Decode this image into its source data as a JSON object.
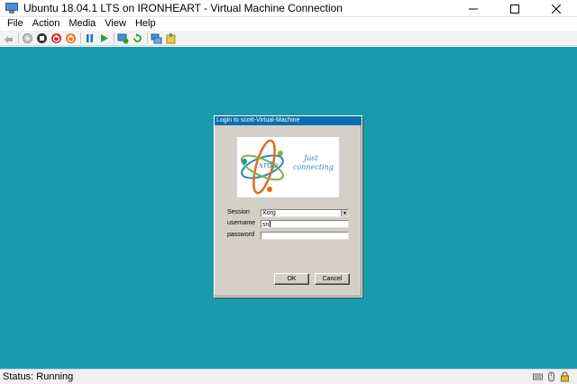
{
  "window": {
    "title": "Ubuntu 18.04.1 LTS on IRONHEART - Virtual Machine Connection",
    "controls": {
      "minimize": "—",
      "maximize": "☐",
      "close": "✕"
    }
  },
  "menubar": {
    "items": [
      {
        "label": "File"
      },
      {
        "label": "Action"
      },
      {
        "label": "Media"
      },
      {
        "label": "View"
      },
      {
        "label": "Help"
      }
    ]
  },
  "toolbar": {
    "buttons": [
      {
        "icon": "ctrl-alt-del-icon"
      },
      {
        "icon": "start-icon"
      },
      {
        "icon": "turn-off-icon"
      },
      {
        "icon": "shut-down-icon"
      },
      {
        "icon": "save-state-icon"
      },
      {
        "icon": "pause-icon"
      },
      {
        "icon": "resume-icon"
      },
      {
        "icon": "checkpoint-icon"
      },
      {
        "icon": "revert-icon"
      },
      {
        "icon": "enhanced-session-icon"
      },
      {
        "icon": "share-icon"
      }
    ]
  },
  "vm": {
    "background": "#1a9aad"
  },
  "login_dialog": {
    "title": "Login to scott-Virtual-Machine",
    "logo": {
      "brand": "xrdp",
      "tagline_line1": "Just",
      "tagline_line2": "connecting"
    },
    "session": {
      "label": "Session",
      "value": "Xorg"
    },
    "username": {
      "label": "username",
      "value": "sn"
    },
    "password": {
      "label": "password",
      "value": ""
    },
    "ok_label": "OK",
    "cancel_label": "Cancel"
  },
  "statusbar": {
    "status": "Status: Running",
    "icons": [
      "keyboard-icon",
      "mouse-icon",
      "lock-icon"
    ]
  },
  "colors": {
    "vm_background": "#1a9aad",
    "dialog_title_bar": "#0a6fb0",
    "dialog_body": "#d4d0c8"
  }
}
